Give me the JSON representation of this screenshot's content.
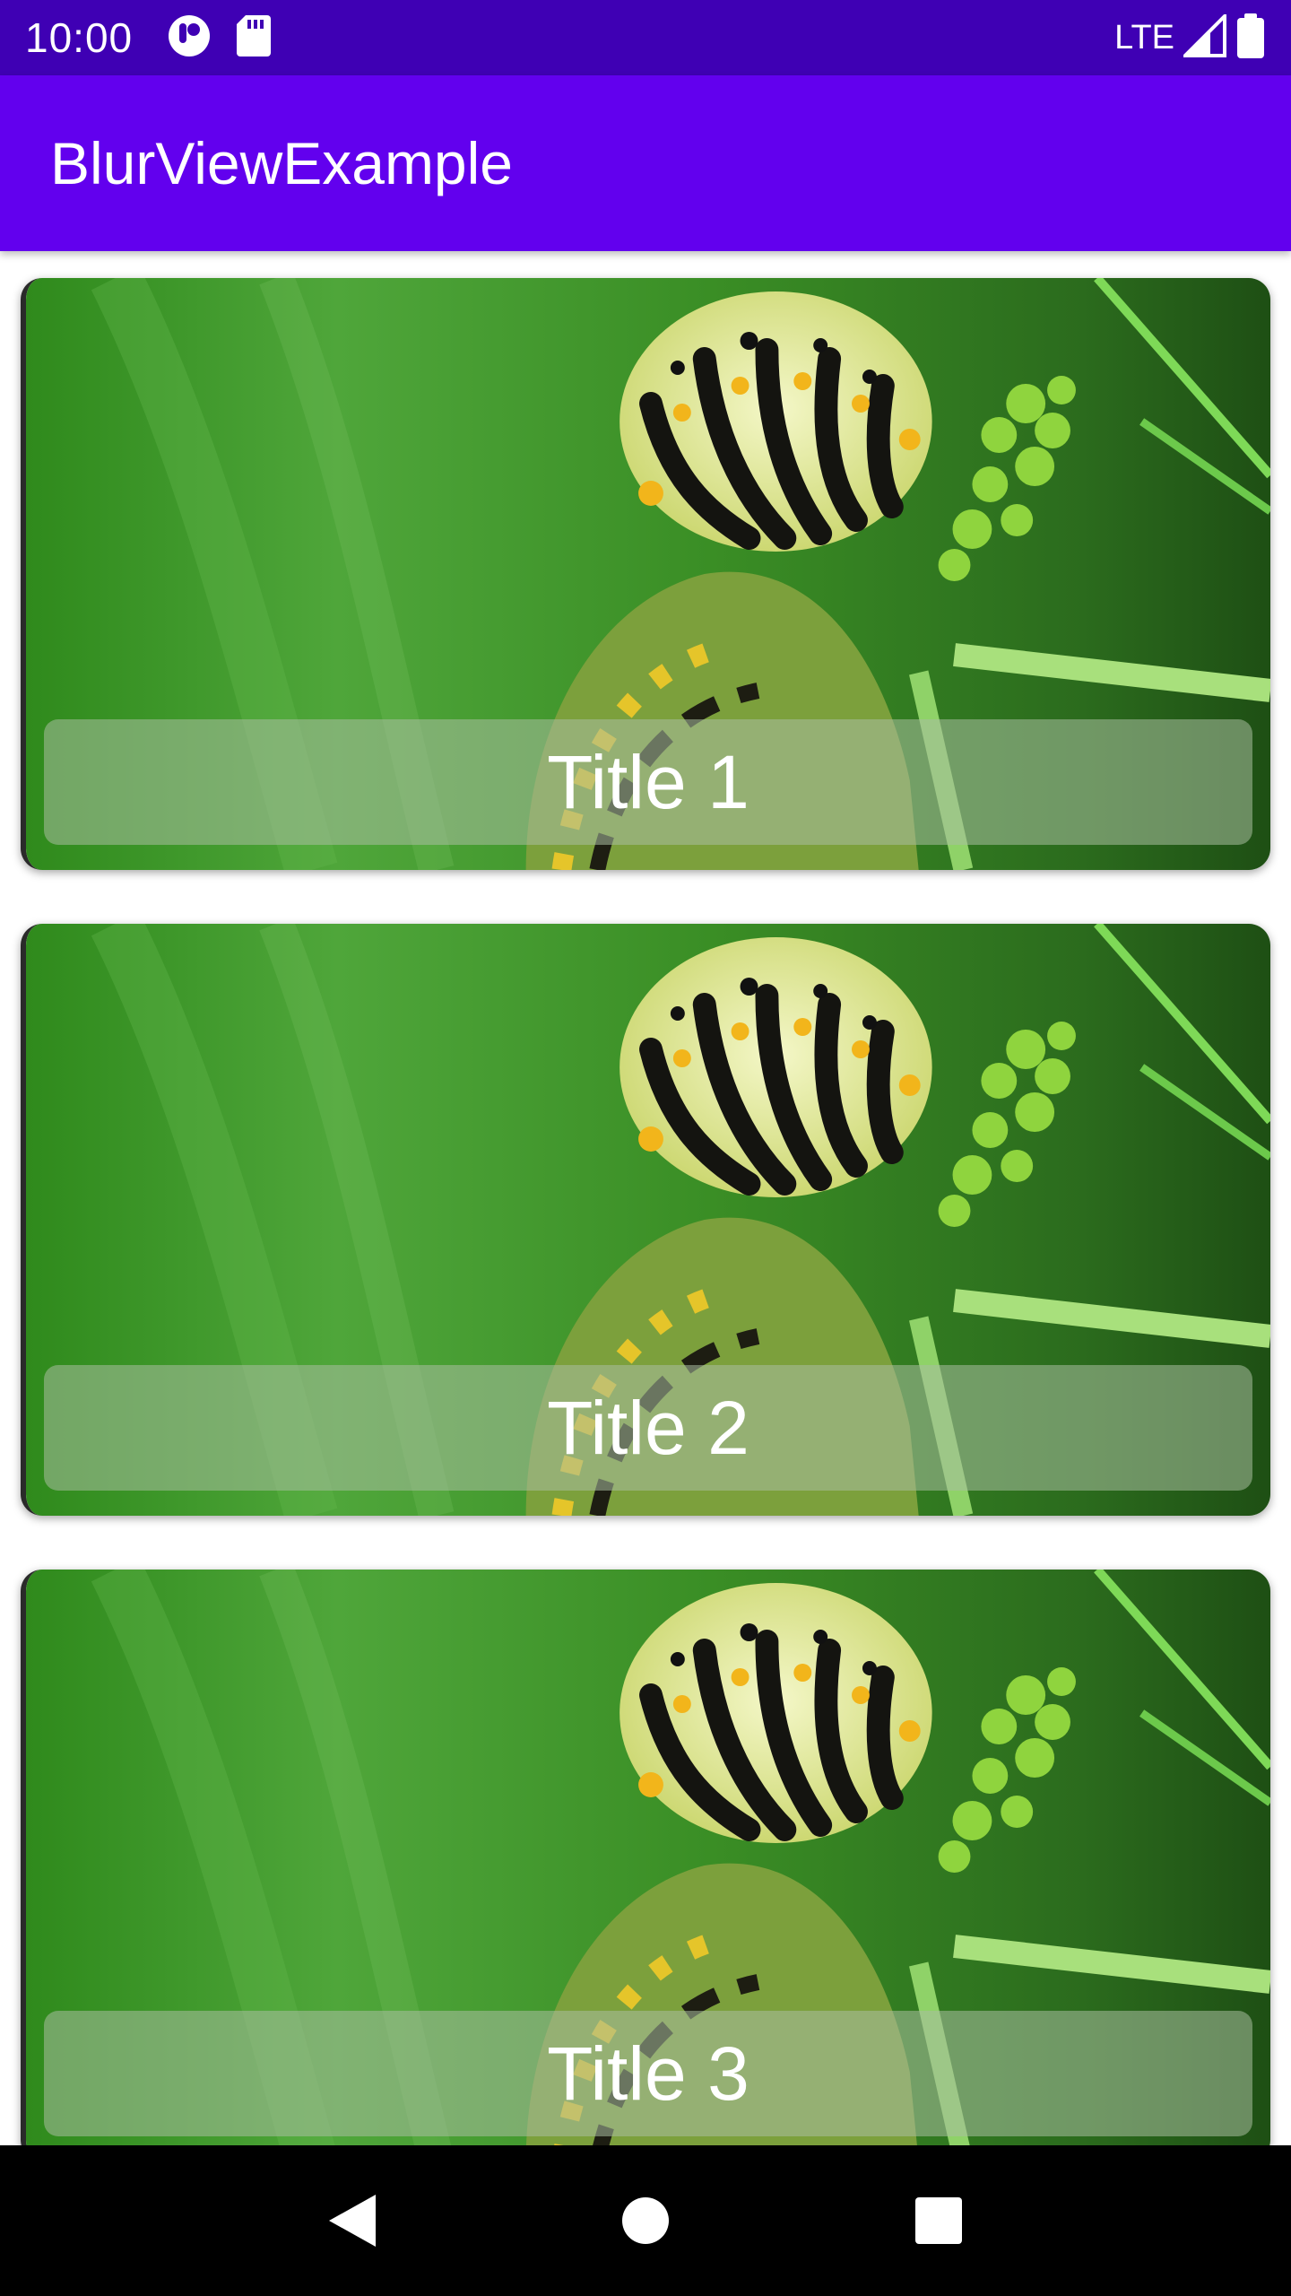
{
  "status_bar": {
    "time": "10:00",
    "network": "LTE",
    "icons": [
      "notification-app-icon",
      "sd-card-icon",
      "signal-icon",
      "battery-icon"
    ]
  },
  "app_bar": {
    "title": "BlurViewExample"
  },
  "cards": [
    {
      "title": "Title 1",
      "image": "caterpillar-photo"
    },
    {
      "title": "Title 2",
      "image": "caterpillar-photo"
    },
    {
      "title": "Title 3",
      "image": "caterpillar-photo"
    }
  ],
  "nav_bar": {
    "icons": [
      "back-icon",
      "home-icon",
      "recents-icon"
    ]
  },
  "colors": {
    "status_bar": "#3f00b4",
    "app_bar": "#6200ee",
    "nav_bar": "#000000"
  }
}
